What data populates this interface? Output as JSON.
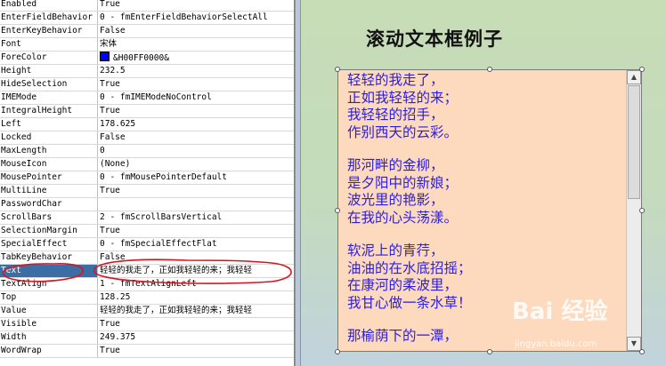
{
  "properties": [
    {
      "name": "Enabled",
      "value": "True"
    },
    {
      "name": "EnterFieldBehavior",
      "value": "0 - fmEnterFieldBehaviorSelectAll"
    },
    {
      "name": "EnterKeyBehavior",
      "value": "False"
    },
    {
      "name": "Font",
      "value": "宋体"
    },
    {
      "name": "ForeColor",
      "value": "&H00FF0000&"
    },
    {
      "name": "Height",
      "value": "232.5"
    },
    {
      "name": "HideSelection",
      "value": "True"
    },
    {
      "name": "IMEMode",
      "value": "0 - fmIMEModeNoControl"
    },
    {
      "name": "IntegralHeight",
      "value": "True"
    },
    {
      "name": "Left",
      "value": "178.625"
    },
    {
      "name": "Locked",
      "value": "False"
    },
    {
      "name": "MaxLength",
      "value": "0"
    },
    {
      "name": "MouseIcon",
      "value": "(None)"
    },
    {
      "name": "MousePointer",
      "value": "0 - fmMousePointerDefault"
    },
    {
      "name": "MultiLine",
      "value": "True"
    },
    {
      "name": "PasswordChar",
      "value": ""
    },
    {
      "name": "ScrollBars",
      "value": "2 - fmScrollBarsVertical"
    },
    {
      "name": "SelectionMargin",
      "value": "True"
    },
    {
      "name": "SpecialEffect",
      "value": "0 - fmSpecialEffectFlat"
    },
    {
      "name": "TabKeyBehavior",
      "value": "False"
    },
    {
      "name": "Text",
      "value": "轻轻的我走了，正如我轻轻的来；我轻轻"
    },
    {
      "name": "TextAlign",
      "value": "1 - fmTextAlignLeft"
    },
    {
      "name": "Top",
      "value": "128.25"
    },
    {
      "name": "Value",
      "value": "轻轻的我走了，正如我轻轻的来；我轻轻"
    },
    {
      "name": "Visible",
      "value": "True"
    },
    {
      "name": "Width",
      "value": "249.375"
    },
    {
      "name": "WordWrap",
      "value": "True"
    }
  ],
  "selected_property": "Text",
  "form": {
    "title": "滚动文本框例子",
    "textbox_lines": [
      "轻轻的我走了，",
      "正如我轻轻的来；",
      "我轻轻的招手，",
      "作别西天的云彩。",
      "",
      "那河畔的金柳，",
      "是夕阳中的新娘；",
      "波光里的艳影，",
      "在我的心头荡漾。",
      "",
      "软泥上的青荇，",
      "油油的在水底招摇；",
      "在康河的柔波里，",
      "我甘心做一条水草！",
      "",
      "那榆荫下的一潭，"
    ]
  },
  "scrollbar": {
    "up_icon": "triangle-up",
    "down_icon": "triangle-down"
  },
  "watermark": {
    "main": "Bai 经验",
    "sub": "jingyan.baidu.com"
  },
  "colors": {
    "forecolor_swatch": "#0000ff",
    "text_color": "#2b1de0",
    "textbox_bg": "#fdd9bd",
    "annotation": "#e0101c"
  }
}
